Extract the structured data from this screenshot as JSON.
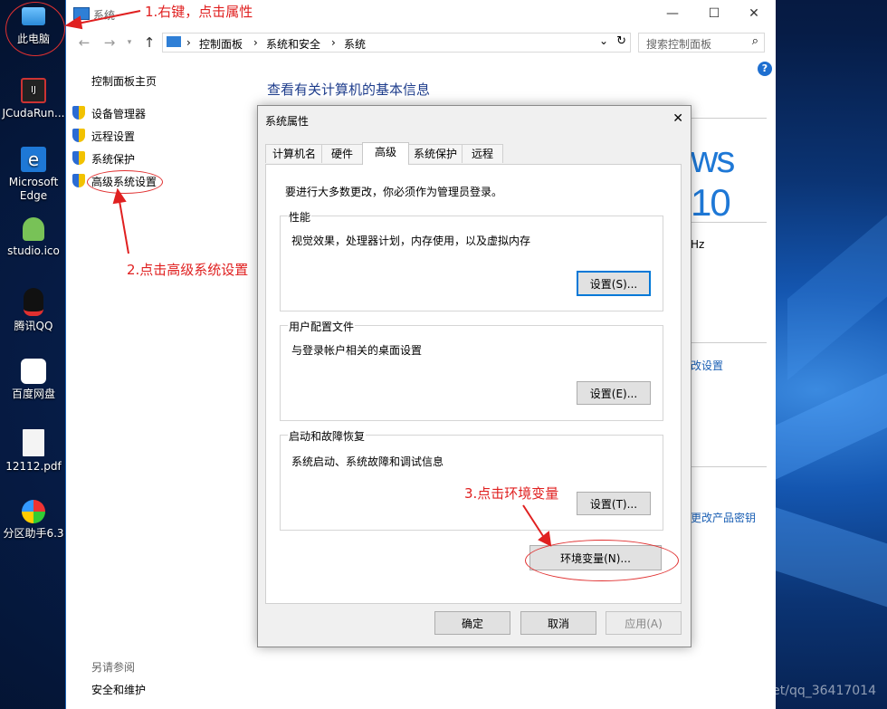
{
  "desktop": {
    "icons": [
      {
        "label": "此电脑",
        "icon": "computer-icon"
      },
      {
        "label": "JCudaRun...",
        "icon": "intellij-icon"
      },
      {
        "label": "Microsoft Edge",
        "icon": "edge-icon"
      },
      {
        "label": "studio.ico",
        "icon": "android-studio-icon"
      },
      {
        "label": "腾讯QQ",
        "icon": "qq-icon"
      },
      {
        "label": "百度网盘",
        "icon": "baidu-netdisk-icon"
      },
      {
        "label": "12112.pdf",
        "icon": "pdf-file-icon"
      },
      {
        "label": "分区助手6.3",
        "icon": "partition-assistant-icon"
      }
    ]
  },
  "window": {
    "title": "系统",
    "breadcrumb": [
      "控制面板",
      "系统和安全",
      "系统"
    ],
    "search_placeholder": "搜索控制面板",
    "left_pane": {
      "home": "控制面板主页",
      "links": [
        "设备管理器",
        "远程设置",
        "系统保护",
        "高级系统设置"
      ],
      "see_also_title": "另请参阅",
      "see_also": [
        "安全和维护"
      ]
    },
    "main_title": "查看有关计算机的基本信息",
    "windows_brand": "ws 10",
    "partial_texts": {
      "hz": "Hz",
      "change_settings": "改设置",
      "change_key": "更改产品密钥"
    }
  },
  "dialog": {
    "title": "系统属性",
    "tabs": [
      "计算机名",
      "硬件",
      "高级",
      "系统保护",
      "远程"
    ],
    "active_tab": "高级",
    "admin_notice": "要进行大多数更改，你必须作为管理员登录。",
    "groups": [
      {
        "title": "性能",
        "desc": "视觉效果，处理器计划，内存使用，以及虚拟内存",
        "button": "设置(S)..."
      },
      {
        "title": "用户配置文件",
        "desc": "与登录帐户相关的桌面设置",
        "button": "设置(E)..."
      },
      {
        "title": "启动和故障恢复",
        "desc": "系统启动、系统故障和调试信息",
        "button": "设置(T)..."
      }
    ],
    "env_button": "环境变量(N)...",
    "ok": "确定",
    "cancel": "取消",
    "apply": "应用(A)"
  },
  "annotations": {
    "step1": "1.右键，点击属性",
    "step2": "2.点击高级系统设置",
    "step3": "3.点击环境变量",
    "color": "#e02020"
  },
  "watermark": "https://blog.csdn.net/qq_36417014"
}
